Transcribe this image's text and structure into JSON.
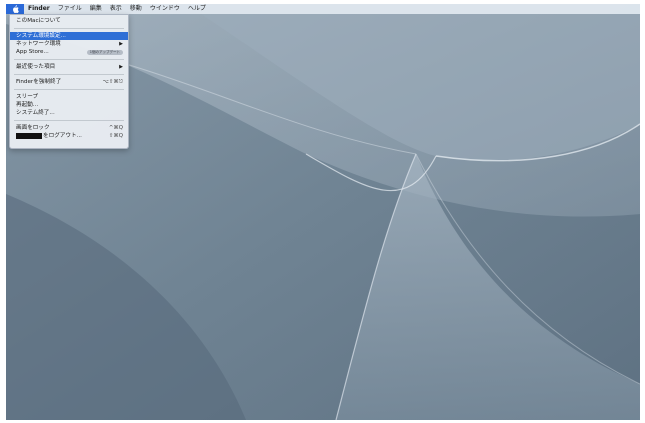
{
  "menubar": {
    "apple_icon": "apple-logo-icon",
    "items": [
      "Finder",
      "ファイル",
      "編集",
      "表示",
      "移動",
      "ウインドウ",
      "ヘルプ"
    ]
  },
  "apple_menu": {
    "about": "このMacについて",
    "system_prefs": "システム環境設定...",
    "network": "ネットワーク環境",
    "app_store": "App Store...",
    "app_store_badge": "1個のアップデート",
    "recent": "最近使った項目",
    "force_quit": "Finderを強制終了",
    "force_quit_shortcut": "⌥⇧⌘⎋",
    "sleep": "スリープ",
    "restart": "再起動...",
    "shutdown": "システム終了...",
    "lock": "画面をロック",
    "lock_shortcut": "^⌘Q",
    "logout": "をログアウト...",
    "logout_shortcut": "⇧⌘Q",
    "submenu_arrow": "▶"
  },
  "colors": {
    "menu_highlight": "#2f6fd6",
    "wallpaper": "#6a7d8d"
  }
}
